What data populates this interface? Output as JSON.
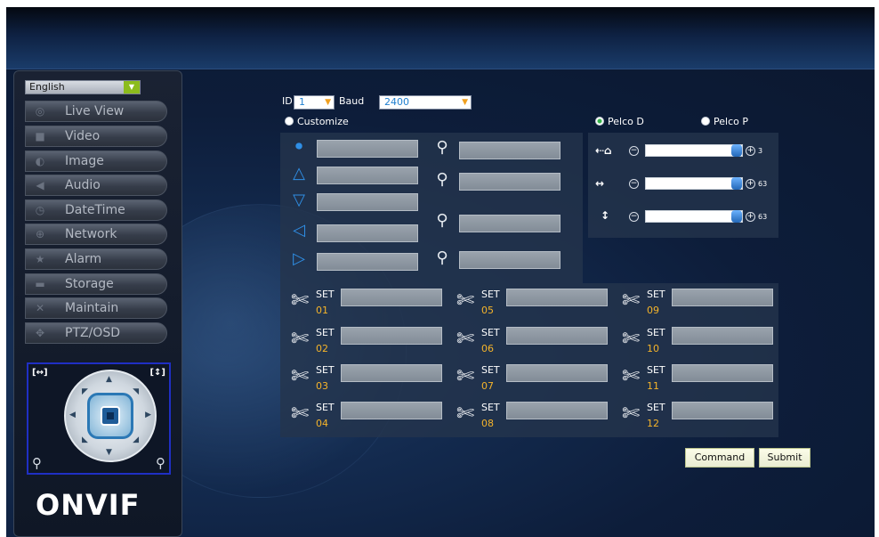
{
  "language": {
    "selected": "English"
  },
  "menu": [
    {
      "label": "Live View",
      "icon": "chat-icon"
    },
    {
      "label": "Video",
      "icon": "camera-icon"
    },
    {
      "label": "Image",
      "icon": "image-icon"
    },
    {
      "label": "Audio",
      "icon": "speaker-icon"
    },
    {
      "label": "DateTime",
      "icon": "clock-icon"
    },
    {
      "label": "Network",
      "icon": "network-icon"
    },
    {
      "label": "Alarm",
      "icon": "alarm-icon"
    },
    {
      "label": "Storage",
      "icon": "storage-icon"
    },
    {
      "label": "Maintain",
      "icon": "tools-icon"
    },
    {
      "label": "PTZ/OSD",
      "icon": "ptz-icon"
    }
  ],
  "ptz_form": {
    "id_label": "ID",
    "id_value": "1",
    "baud_label": "Baud",
    "baud_value": "2400",
    "customize_label": "Customize",
    "protocol_options": [
      "Pelco D",
      "Pelco P"
    ],
    "protocol_selected": "Pelco D"
  },
  "sliders": [
    {
      "icon": "home-speed-icon",
      "value": "3",
      "level": 1.0
    },
    {
      "icon": "pan-speed-icon",
      "value": "63",
      "level": 1.0
    },
    {
      "icon": "tilt-speed-icon",
      "value": "63",
      "level": 1.0
    }
  ],
  "presets": {
    "set_label": "SET",
    "numbers": [
      "01",
      "02",
      "03",
      "04",
      "05",
      "06",
      "07",
      "08",
      "09",
      "10",
      "11",
      "12"
    ]
  },
  "buttons": {
    "command": "Command",
    "submit": "Submit"
  },
  "logo": {
    "text": "ONVIF"
  }
}
